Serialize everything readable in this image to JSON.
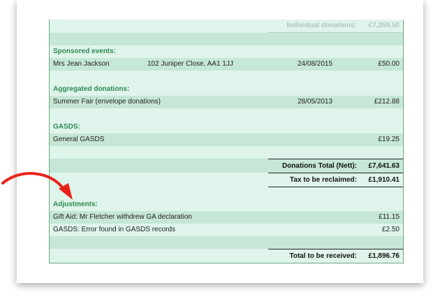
{
  "faded_total": {
    "label": "Individual donations:",
    "amount": "£7,359.50"
  },
  "sponsored": {
    "heading": "Sponsored events:",
    "row": {
      "name": "Mrs Jean Jackson",
      "address": "102 Juniper Close, AA1 1JJ",
      "date": "24/08/2015",
      "amount": "£50.00"
    }
  },
  "aggregated": {
    "heading": "Aggregated donations:",
    "row": {
      "name": "Summer Fair (envelope donations)",
      "date": "28/05/2013",
      "amount": "£212.88"
    }
  },
  "gasds": {
    "heading": "GASDS:",
    "row": {
      "name": "General GASDS",
      "amount": "£19.25"
    }
  },
  "totals": {
    "donations_label": "Donations Total (Nett):",
    "donations_value": "£7,641.63",
    "tax_label": "Tax to be reclaimed:",
    "tax_value": "£1,910.41"
  },
  "adjustments": {
    "heading": "Adjustments:",
    "rows": [
      {
        "name": "Gift Aid: Mr Fletcher withdrew GA declaration",
        "amount": "£11.15"
      },
      {
        "name": "GASDS: Error found in GASDS records",
        "amount": "£2.50"
      }
    ]
  },
  "final": {
    "label": "Total to be received:",
    "value": "£1,896.76"
  },
  "colors": {
    "heading": "#2e8a57",
    "row_dark": "#c6e7d6",
    "row_light": "#dff4ea",
    "arrow": "#e8231b"
  },
  "icons": {
    "pointer": "red-curved-arrow-icon"
  }
}
